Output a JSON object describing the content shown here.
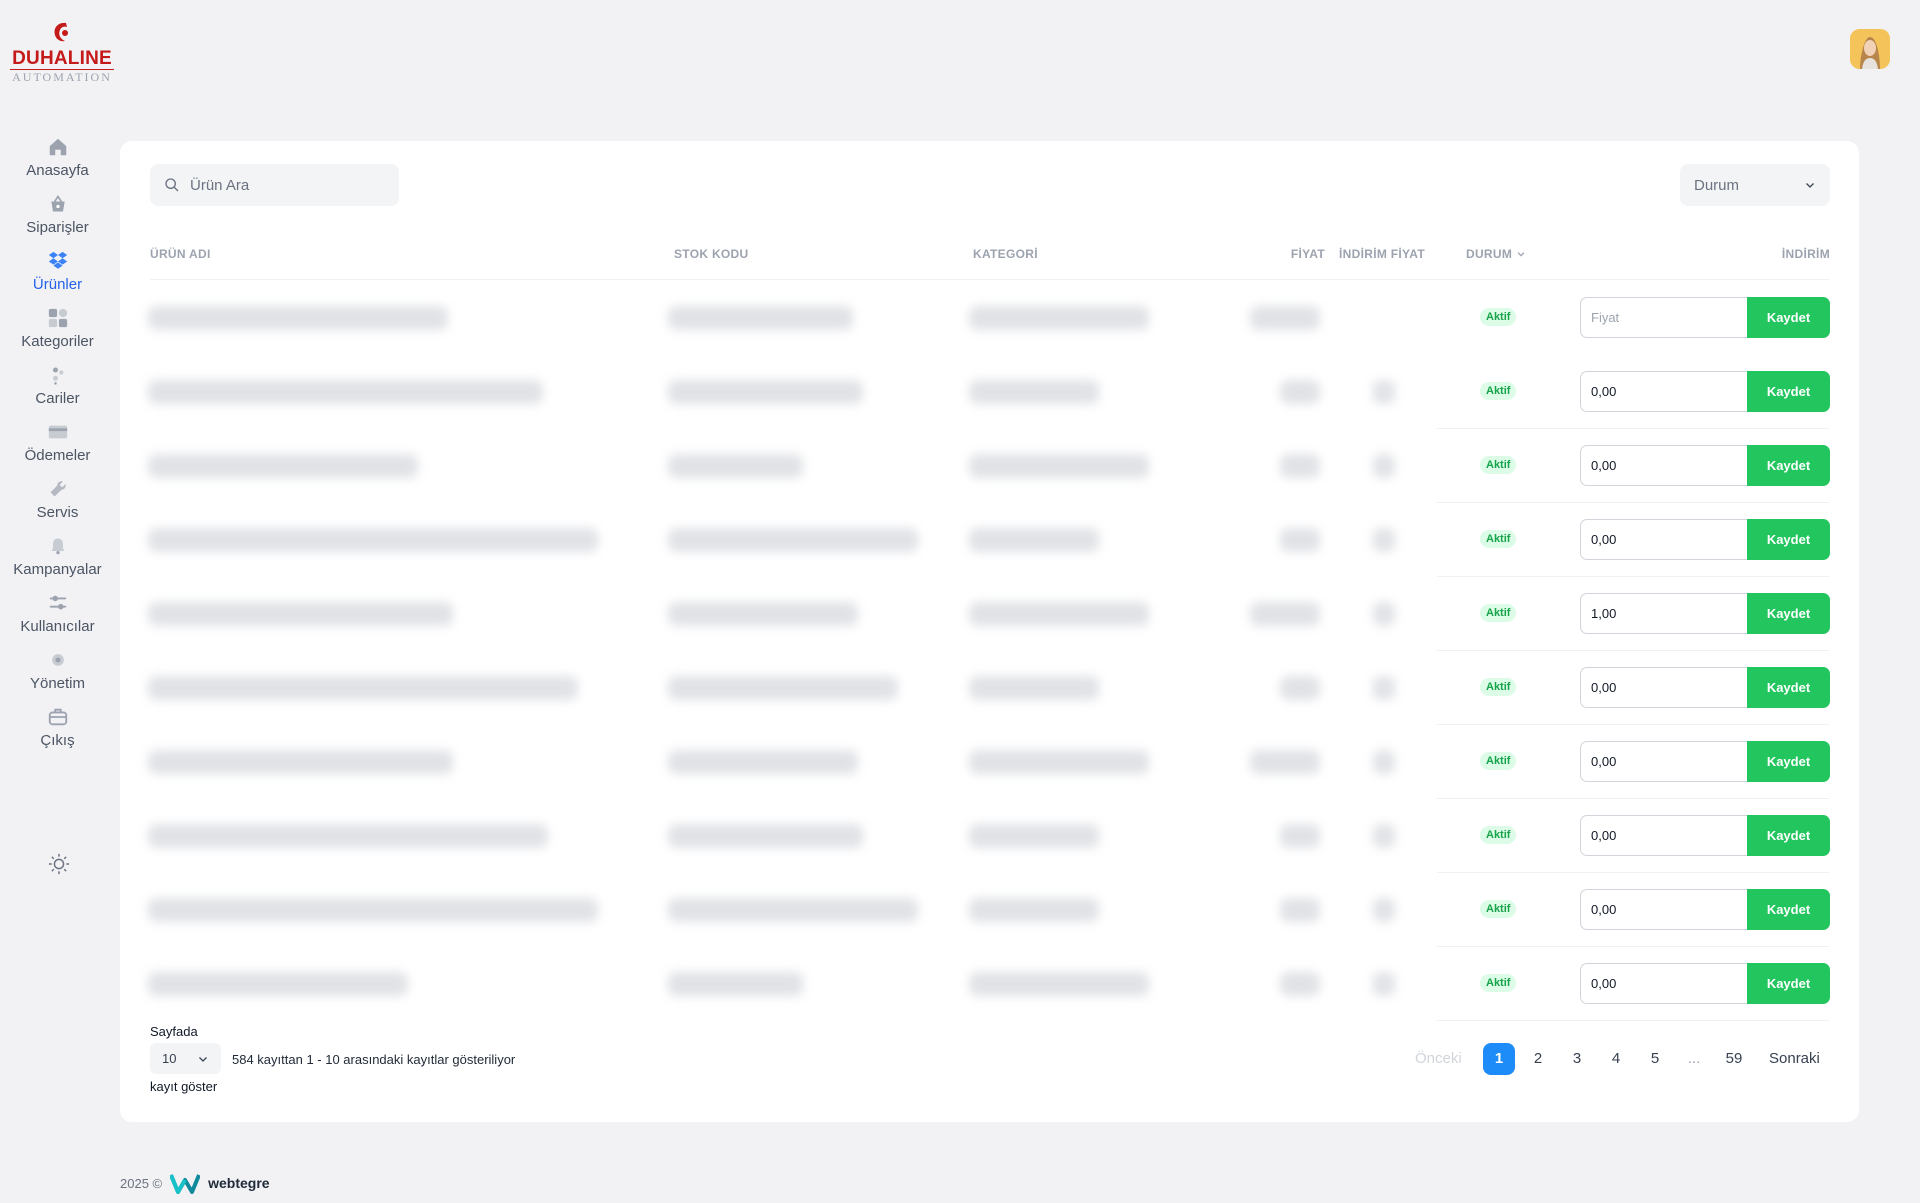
{
  "logo": {
    "title": "DUHALINE",
    "subtitle": "AUTOMATION"
  },
  "sidebar": {
    "items": [
      {
        "label": "Anasayfa",
        "icon": "home-icon"
      },
      {
        "label": "Siparişler",
        "icon": "basket-icon"
      },
      {
        "label": "Ürünler",
        "icon": "dropbox-icon",
        "active": true
      },
      {
        "label": "Kategoriler",
        "icon": "grid-icon"
      },
      {
        "label": "Cariler",
        "icon": "users-icon"
      },
      {
        "label": "Ödemeler",
        "icon": "credit-card-icon"
      },
      {
        "label": "Servis",
        "icon": "wrench-icon"
      },
      {
        "label": "Kampanyalar",
        "icon": "bell-icon"
      },
      {
        "label": "Kullanıcılar",
        "icon": "sliders-icon"
      },
      {
        "label": "Yönetim",
        "icon": "gear-icon"
      },
      {
        "label": "Çıkış",
        "icon": "briefcase-icon"
      }
    ]
  },
  "search": {
    "placeholder": "Ürün Ara"
  },
  "filter": {
    "label": "Durum"
  },
  "table": {
    "headers": {
      "name": "ÜRÜN ADI",
      "stock_code": "STOK KODU",
      "category": "KATEGORİ",
      "price": "FİYAT",
      "discount_price": "İNDİRİM FİYAT",
      "status": "DURUM",
      "discount": "İNDİRİM"
    },
    "rows": [
      {
        "status": "Aktif",
        "discount_value": "",
        "discount_placeholder": "Fiyat",
        "save": "Kaydet"
      },
      {
        "status": "Aktif",
        "discount_value": "0,00",
        "discount_placeholder": "Fiyat",
        "save": "Kaydet"
      },
      {
        "status": "Aktif",
        "discount_value": "0,00",
        "discount_placeholder": "Fiyat",
        "save": "Kaydet"
      },
      {
        "status": "Aktif",
        "discount_value": "0,00",
        "discount_placeholder": "Fiyat",
        "save": "Kaydet"
      },
      {
        "status": "Aktif",
        "discount_value": "1,00",
        "discount_placeholder": "Fiyat",
        "save": "Kaydet"
      },
      {
        "status": "Aktif",
        "discount_value": "0,00",
        "discount_placeholder": "Fiyat",
        "save": "Kaydet"
      },
      {
        "status": "Aktif",
        "discount_value": "0,00",
        "discount_placeholder": "Fiyat",
        "save": "Kaydet"
      },
      {
        "status": "Aktif",
        "discount_value": "0,00",
        "discount_placeholder": "Fiyat",
        "save": "Kaydet"
      },
      {
        "status": "Aktif",
        "discount_value": "0,00",
        "discount_placeholder": "Fiyat",
        "save": "Kaydet"
      },
      {
        "status": "Aktif",
        "discount_value": "0,00",
        "discount_placeholder": "Fiyat",
        "save": "Kaydet"
      }
    ]
  },
  "footer": {
    "per_page_label": "Sayfada",
    "per_page_value": "10",
    "per_page_suffix": "kayıt göster",
    "records_info": "584 kayıttan 1 - 10 arasındaki kayıtlar gösteriliyor"
  },
  "pagination": {
    "prev": "Önceki",
    "pages": [
      "1",
      "2",
      "3",
      "4",
      "5",
      "...",
      "59"
    ],
    "current": "1",
    "next": "Sonraki"
  },
  "copyright": {
    "text": "2025 ©",
    "brand": "webtegre"
  },
  "colors": {
    "accent": "#2563eb",
    "success": "#22c55e",
    "brand_red": "#c51a1a",
    "page_current": "#1d8cf8"
  }
}
